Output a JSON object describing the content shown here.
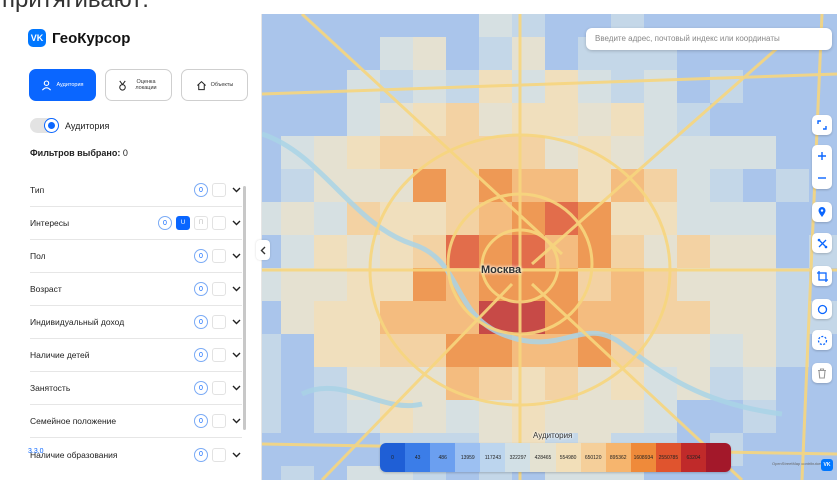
{
  "top_text": "притягивают:",
  "app": {
    "logo_text": "ГеоКурсор",
    "logo_mark": "VK",
    "version": "3.3.0"
  },
  "modes": [
    {
      "label": "Аудитория",
      "active": true,
      "icon": "person-icon"
    },
    {
      "label": "Оценка локации",
      "active": false,
      "icon": "medal-icon"
    },
    {
      "label": "Объекты",
      "active": false,
      "icon": "house-icon"
    }
  ],
  "audience_toggle": {
    "label": "Аудитория",
    "on": true
  },
  "filters_selected": {
    "label": "Фильтров выбрано:",
    "count": "0"
  },
  "filters": [
    {
      "label": "Тип",
      "count": "0",
      "extra": []
    },
    {
      "label": "Интересы",
      "count": "0",
      "extra": [
        "U",
        "П"
      ]
    },
    {
      "label": "Пол",
      "count": "0",
      "extra": []
    },
    {
      "label": "Возраст",
      "count": "0",
      "extra": []
    },
    {
      "label": "Индивидуальный доход",
      "count": "0",
      "extra": []
    },
    {
      "label": "Наличие детей",
      "count": "0",
      "extra": []
    },
    {
      "label": "Занятость",
      "count": "0",
      "extra": []
    },
    {
      "label": "Семейное положение",
      "count": "0",
      "extra": []
    },
    {
      "label": "Наличие образования",
      "count": "0",
      "extra": []
    }
  ],
  "map": {
    "search_placeholder": "Введите адрес, почтовый индекс или координаты",
    "city_label": "Москва",
    "legend_title": "Аудитория",
    "legend": [
      {
        "label": "0",
        "color": "#1f5fd6"
      },
      {
        "label": "43",
        "color": "#3b7de8"
      },
      {
        "label": "486",
        "color": "#6b9ff0"
      },
      {
        "label": "13959",
        "color": "#9cc0f2"
      },
      {
        "label": "117243",
        "color": "#bcd5ee"
      },
      {
        "label": "322297",
        "color": "#d2e0e6"
      },
      {
        "label": "428465",
        "color": "#e4e2d2"
      },
      {
        "label": "554980",
        "color": "#f2dfb9"
      },
      {
        "label": "650120",
        "color": "#f5cf9a"
      },
      {
        "label": "895362",
        "color": "#f6b56e"
      },
      {
        "label": "1608934",
        "color": "#ef8a3a"
      },
      {
        "label": "2550785",
        "color": "#e0542e"
      },
      {
        "label": "63204",
        "color": "#c02a2a"
      },
      {
        "label": "",
        "color": "#a3182a"
      }
    ],
    "attribution": "OpenStreetMap contributors",
    "tools": [
      "expand-icon",
      "zoom-in-icon",
      "zoom-out-icon",
      "pin-icon",
      "polygon-icon",
      "isochrone-icon",
      "circle-icon",
      "dashed-circle-icon",
      "trash-icon"
    ]
  }
}
